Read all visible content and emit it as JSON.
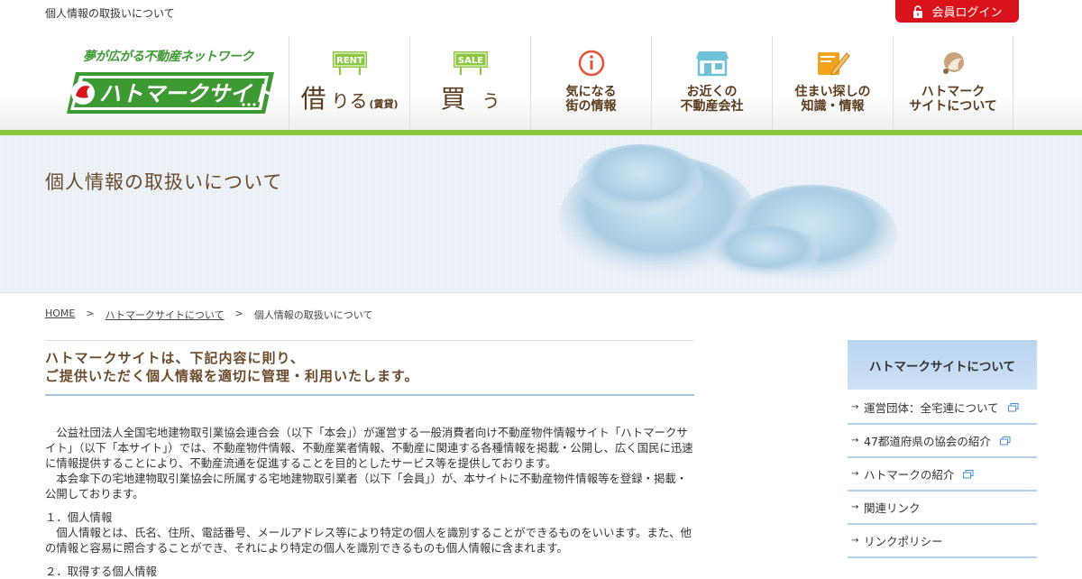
{
  "topbar": {
    "tagline": "個人情報の取扱いについて",
    "login_label": "会員ログイン"
  },
  "logo": {
    "catch": "夢が広がる不動産ネットワーク",
    "brand": "ハトマークサイト"
  },
  "nav": {
    "rent": {
      "badge": "RENT",
      "main": "借",
      "sub": "りる",
      "note": "(賃貸)"
    },
    "sale": {
      "badge": "SALE",
      "main": "買",
      "sub": "う"
    },
    "info": {
      "label": "気になる\n街の情報"
    },
    "companies": {
      "label": "お近くの\n不動産会社"
    },
    "knowledge": {
      "label": "住まい探しの\n知識・情報"
    },
    "about": {
      "label": "ハトマーク\nサイトについて"
    }
  },
  "hero": {
    "title": "個人情報の取扱いについて"
  },
  "breadcrumb": {
    "home": "HOME",
    "sep1": ">",
    "parent": "ハトマークサイトについて",
    "sep2": ">",
    "current": "個人情報の取扱いについて"
  },
  "lead": {
    "line1": "ハトマークサイトは、下記内容に則り、",
    "line2": "ご提供いただく個人情報を適切に管理・利用いたします。"
  },
  "body": {
    "p1": "公益社団法人全国宅地建物取引業協会連合会（以下「本会」）が運営する一般消費者向け不動産物件情報サイト「ハトマークサイト」（以下「本サイト」）では、不動産物件情報、不動産業者情報、不動産に関連する各種情報を掲載・公開し、広く国民に迅速に情報提供することにより、不動産流通を促進することを目的としたサービス等を提供しております。",
    "p2": "本会傘下の宅地建物取引業協会に所属する宅地建物取引業者（以下「会員」）が、本サイトに不動産物件情報等を登録・掲載・公開しております。",
    "s1_title": "１．個人情報",
    "s1_text": "個人情報とは、氏名、住所、電話番号、メールアドレス等により特定の個人を識別することができるものをいいます。また、他の情報と容易に照合することができ、それにより特定の個人を識別できるものも個人情報に含まれます。",
    "s2_title": "２．取得する個人情報"
  },
  "sidebar": {
    "heading": "ハトマークサイトについて",
    "items": [
      {
        "label": "運営団体：全宅連について",
        "external": true
      },
      {
        "label": "47都道府県の協会の紹介",
        "external": true
      },
      {
        "label": "ハトマークの紹介",
        "external": true
      },
      {
        "label": "関連リンク",
        "external": false
      },
      {
        "label": "リンクポリシー",
        "external": false
      }
    ]
  },
  "colors": {
    "accent_red": "#d9131a",
    "brand_green": "#8cc63f",
    "heading_brown": "#6b4a2a",
    "sidebar_blue": "#b8d4f0"
  }
}
